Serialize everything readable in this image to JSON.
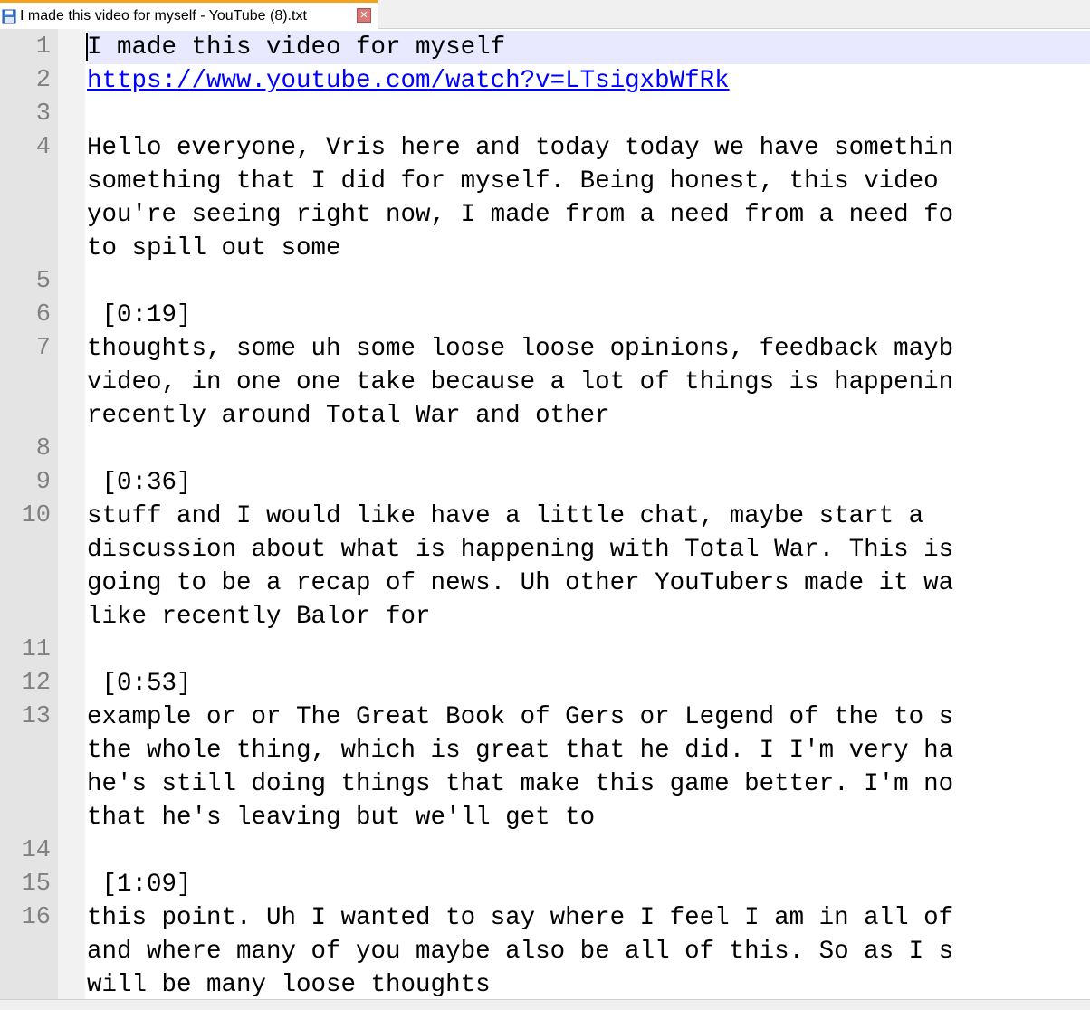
{
  "tab": {
    "title": "I made this video for myself - YouTube (8).txt",
    "icon": "floppy-disk-icon",
    "close_glyph": "✕"
  },
  "editor": {
    "lines": [
      {
        "number": "1",
        "current": true,
        "text": [
          "I made this video for myself"
        ]
      },
      {
        "number": "2",
        "link": true,
        "text": [
          "https://www.youtube.com/watch?v=LTsigxbWfRk"
        ]
      },
      {
        "number": "3",
        "text": [
          ""
        ]
      },
      {
        "number": "4",
        "text": [
          "Hello everyone, Vris here and today today we have somethin",
          "something that I did for myself. Being honest, this video",
          "you're seeing right now, I made from a need from a need fo",
          "to spill out some"
        ]
      },
      {
        "number": "5",
        "text": [
          ""
        ]
      },
      {
        "number": "6",
        "text": [
          " [0:19]"
        ]
      },
      {
        "number": "7",
        "text": [
          "thoughts, some uh some loose loose opinions, feedback mayb",
          "video, in one one take because a lot of things is happenin",
          "recently around Total War and other"
        ]
      },
      {
        "number": "8",
        "text": [
          ""
        ]
      },
      {
        "number": "9",
        "text": [
          " [0:36]"
        ]
      },
      {
        "number": "10",
        "text": [
          "stuff and I would like have a little chat, maybe start a",
          "discussion about what is happening with Total War. This is",
          "going to be a recap of news. Uh other YouTubers made it wa",
          "like recently Balor for"
        ]
      },
      {
        "number": "11",
        "text": [
          ""
        ]
      },
      {
        "number": "12",
        "text": [
          " [0:53]"
        ]
      },
      {
        "number": "13",
        "text": [
          "example or or The Great Book of Gers or Legend of the to s",
          "the whole thing, which is great that he did. I I'm very ha",
          "he's still doing things that make this game better. I'm no",
          "that he's leaving but we'll get to"
        ]
      },
      {
        "number": "14",
        "text": [
          ""
        ]
      },
      {
        "number": "15",
        "text": [
          " [1:09]"
        ]
      },
      {
        "number": "16",
        "text": [
          "this point. Uh I wanted to say where I feel I am in all of",
          "and where many of you maybe also be all of this. So as I s",
          "will be many loose thoughts"
        ]
      }
    ]
  }
}
